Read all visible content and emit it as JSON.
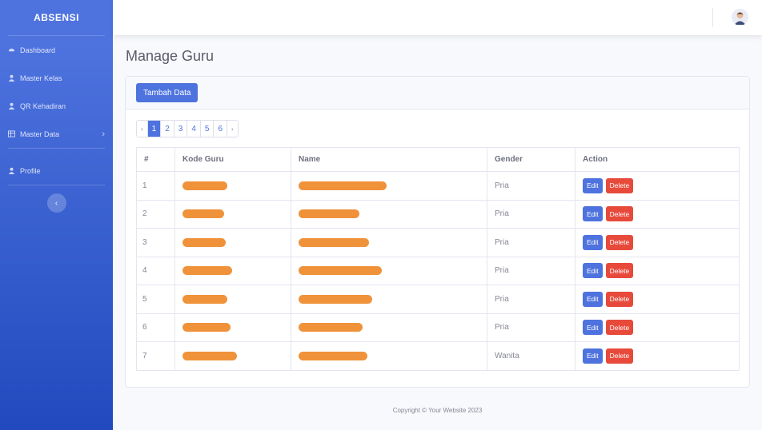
{
  "sidebar": {
    "brand": "ABSENSI",
    "items": [
      {
        "label": "Dashboard",
        "icon": "tachometer-icon"
      },
      {
        "label": "Master Kelas",
        "icon": "user-icon"
      },
      {
        "label": "QR Kehadiran",
        "icon": "user-icon"
      },
      {
        "label": "Master Data",
        "icon": "table-icon"
      },
      {
        "label": "Profile",
        "icon": "user-icon"
      }
    ],
    "toggle_icon": "chevron-left-icon"
  },
  "header": {
    "avatar_icon": "user-avatar"
  },
  "main": {
    "title": "Manage Guru",
    "add_button": "Tambah Data",
    "pagination": [
      "‹",
      "1",
      "2",
      "3",
      "4",
      "5",
      "6",
      "›"
    ],
    "pagination_active": "1",
    "table": {
      "columns": [
        "#",
        "Kode Guru",
        "Name",
        "Gender",
        "Action"
      ],
      "rows": [
        {
          "no": "1",
          "gender": "Pria"
        },
        {
          "no": "2",
          "gender": "Pria"
        },
        {
          "no": "3",
          "gender": "Pria"
        },
        {
          "no": "4",
          "gender": "Pria"
        },
        {
          "no": "5",
          "gender": "Pria"
        },
        {
          "no": "6",
          "gender": "Pria"
        },
        {
          "no": "7",
          "gender": "Wanita"
        }
      ],
      "edit_label": "Edit",
      "delete_label": "Delete"
    }
  },
  "footer": {
    "text": "Copyright © Your Website 2023"
  },
  "colors": {
    "primary": "#4e73df",
    "danger": "#e74a3b",
    "redaction": "#f0923a"
  }
}
